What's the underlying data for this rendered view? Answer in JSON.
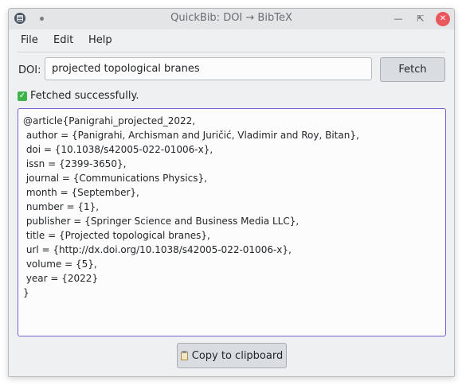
{
  "window": {
    "title": "QuickBib: DOI → BibTeX"
  },
  "menu": {
    "file": "File",
    "edit": "Edit",
    "help": "Help"
  },
  "doi": {
    "label": "DOI:",
    "value": "projected topological branes"
  },
  "fetch_label": "Fetch",
  "status": {
    "icon": "check-icon",
    "text": "Fetched successfully."
  },
  "bibtex": "@article{Panigrahi_projected_2022,\n author = {Panigrahi, Archisman and Juričić, Vladimir and Roy, Bitan},\n doi = {10.1038/s42005-022-01006-x},\n issn = {2399-3650},\n journal = {Communications Physics},\n month = {September},\n number = {1},\n publisher = {Springer Science and Business Media LLC},\n title = {Projected topological branes},\n url = {http://dx.doi.org/10.1038/s42005-022-01006-x},\n volume = {5},\n year = {2022}\n}",
  "copy_label": "Copy to clipboard",
  "colors": {
    "focus_border": "#7a5fcf",
    "close_button": "#e9585d",
    "success": "#3cb44b"
  }
}
